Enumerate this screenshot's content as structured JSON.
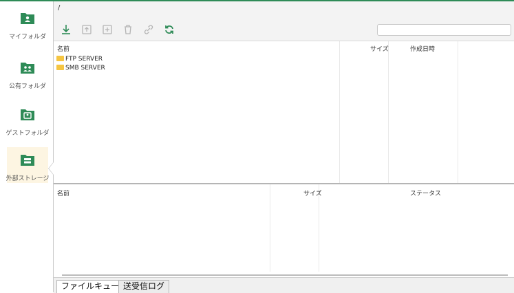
{
  "sidebar": {
    "items": [
      {
        "label": "マイフォルダ",
        "icon": "person-folder-icon"
      },
      {
        "label": "公有フォルダ",
        "icon": "group-folder-icon"
      },
      {
        "label": "ゲストフォルダ",
        "icon": "guest-folder-icon"
      },
      {
        "label": "外部ストレージ",
        "icon": "storage-folder-icon",
        "active": true
      }
    ]
  },
  "path": "/",
  "toolbar": {
    "icons": [
      "download-icon",
      "upload-icon",
      "new-folder-icon",
      "delete-icon",
      "link-icon",
      "refresh-icon"
    ],
    "search_placeholder": ""
  },
  "files": {
    "columns": {
      "name": "名前",
      "size": "サイズ",
      "created": "作成日時"
    },
    "rows": [
      {
        "name": "FTP SERVER"
      },
      {
        "name": "SMB SERVER"
      }
    ]
  },
  "queue": {
    "columns": {
      "name": "名前",
      "size": "サイズ",
      "status": "ステータス"
    }
  },
  "tabs": [
    "ファイルキュー",
    "送受信ログ"
  ],
  "colors": {
    "accent": "#2e8b57",
    "folder": "#f5c542",
    "active_bg": "#fdf5e2"
  }
}
